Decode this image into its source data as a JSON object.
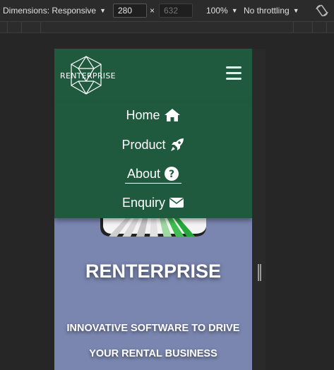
{
  "toolbar": {
    "dimensions_label": "Dimensions: Responsive",
    "width_value": "280",
    "times_sign": "×",
    "height_placeholder": "632",
    "zoom": "100%",
    "throttling": "No throttling",
    "rotate_icon": "rotate-icon"
  },
  "site": {
    "logo_text": "RENTERPRISE",
    "menu": [
      {
        "label": "Home",
        "icon": "home-icon"
      },
      {
        "label": "Product",
        "icon": "rocket-icon"
      },
      {
        "label": "About",
        "icon": "question-circle-icon"
      },
      {
        "label": "Enquiry",
        "icon": "envelope-icon"
      }
    ],
    "active_item": "Home",
    "hero_title": "RENTERPRISE",
    "hero_subtitle_line1": "INNOVATIVE SOFTWARE TO DRIVE",
    "hero_subtitle_line2": "YOUR RENTAL BUSINESS"
  },
  "colors": {
    "nav_bg": "#1f5a3e",
    "hero_bg": "#7a86b0",
    "devtools_bg": "#262626"
  }
}
